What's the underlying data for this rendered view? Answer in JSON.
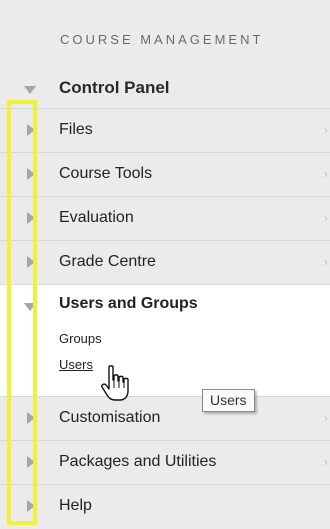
{
  "header": {
    "title": "COURSE MANAGEMENT"
  },
  "control_panel": {
    "label": "Control Panel",
    "icon": "triangle-down-icon"
  },
  "menu_items_top": [
    {
      "label": "Files"
    },
    {
      "label": "Course Tools"
    },
    {
      "label": "Evaluation"
    },
    {
      "label": "Grade Centre"
    }
  ],
  "expanded": {
    "title": "Users and Groups",
    "subitems": [
      {
        "label": "Groups"
      },
      {
        "label": "Users"
      }
    ]
  },
  "menu_items_bottom": [
    {
      "label": "Customisation"
    },
    {
      "label": "Packages and Utilities"
    },
    {
      "label": "Help"
    }
  ],
  "tooltip": {
    "text": "Users"
  },
  "chevron": "›",
  "colors": {
    "highlight": "#f3f03a",
    "panel": "#ebebeb",
    "expanded_bg": "#ffffff"
  }
}
